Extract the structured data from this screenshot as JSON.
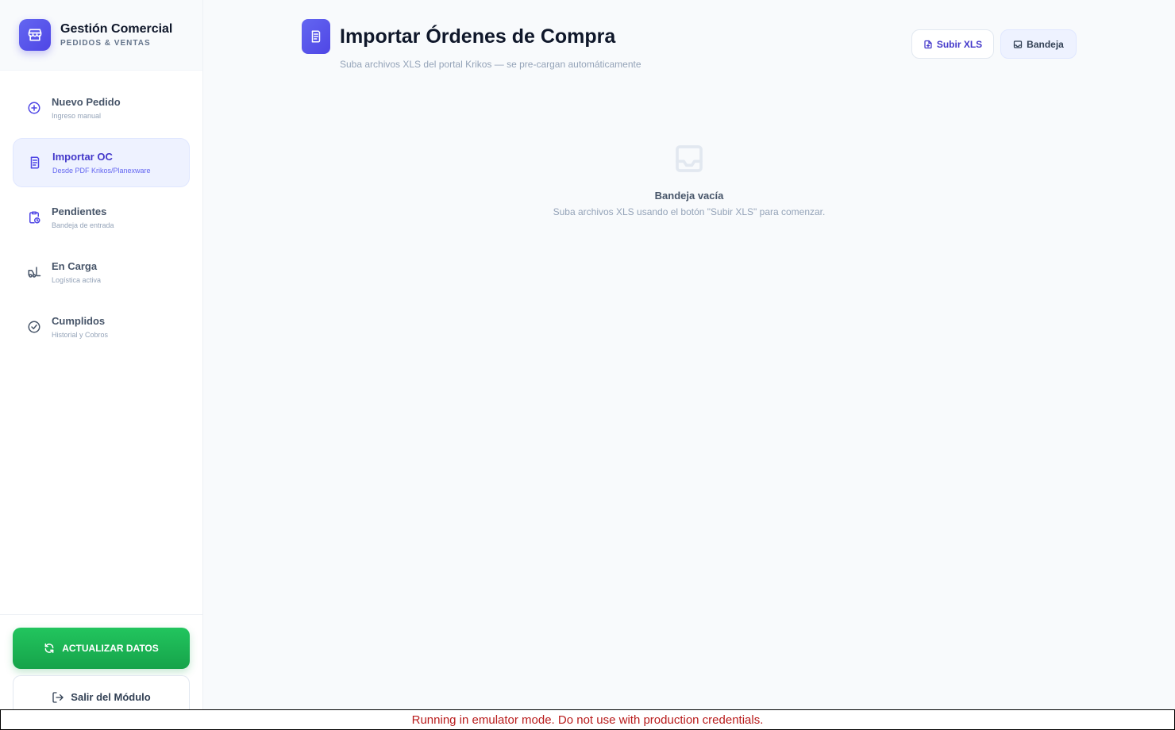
{
  "brand": {
    "title": "Gestión Comercial",
    "subtitle": "PEDIDOS & VENTAS",
    "icon": "store-icon"
  },
  "nav": [
    {
      "label": "Nuevo Pedido",
      "desc": "Ingreso manual",
      "icon": "plus-circle-icon",
      "active": false
    },
    {
      "label": "Importar OC",
      "desc": "Desde PDF Krikos/Planexware",
      "icon": "document-icon",
      "active": true
    },
    {
      "label": "Pendientes",
      "desc": "Bandeja de entrada",
      "icon": "clipboard-clock-icon",
      "active": false
    },
    {
      "label": "En Carga",
      "desc": "Logística activa",
      "icon": "forklift-icon",
      "active": false
    },
    {
      "label": "Cumplidos",
      "desc": "Historial y Cobros",
      "icon": "check-circle-icon",
      "active": false
    }
  ],
  "footer": {
    "refresh_label": "ACTUALIZAR DATOS",
    "exit_label": "Salir del Módulo"
  },
  "header": {
    "title": "Importar Órdenes de Compra",
    "subtitle": "Suba archivos XLS del portal Krikos — se pre-cargan automáticamente",
    "upload_label": "Subir XLS",
    "inbox_label": "Bandeja"
  },
  "empty_state": {
    "title": "Bandeja vacía",
    "text": "Suba archivos XLS usando el botón \"Subir XLS\" para comenzar."
  },
  "banner": {
    "text": "Running in emulator mode. Do not use with production credentials."
  },
  "colors": {
    "accent": "#4f46e5",
    "success": "#16a34a",
    "warning_text": "#b91c1c"
  }
}
